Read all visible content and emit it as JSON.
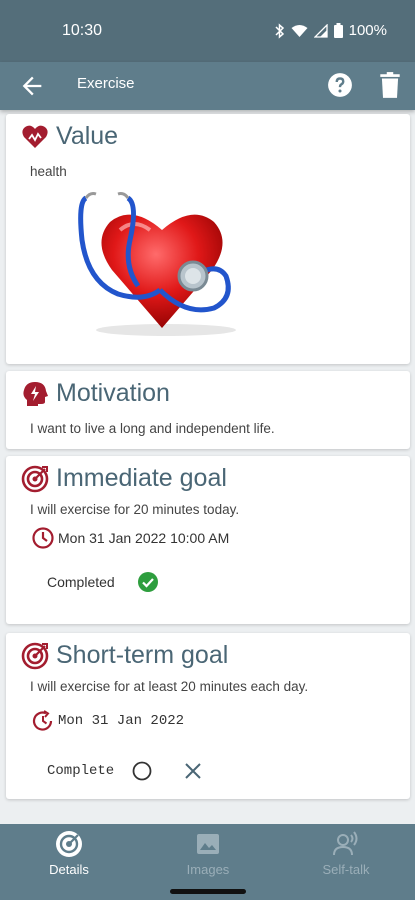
{
  "status_bar": {
    "time": "10:30",
    "battery": "100%"
  },
  "app_bar": {
    "title": "Exercise"
  },
  "value_card": {
    "title": "Value",
    "text": "health"
  },
  "motivation_card": {
    "title": "Motivation",
    "text": "I want to live a long and independent life."
  },
  "immediate_goal_card": {
    "title": "Immediate goal",
    "text": "I will exercise for 20 minutes today.",
    "date": "Mon 31 Jan 2022 10:00 AM",
    "status_label": "Completed"
  },
  "short_term_goal_card": {
    "title": "Short-term goal",
    "text": "I will exercise for at least 20 minutes each day.",
    "date": "Mon 31 Jan 2022",
    "status_label": "Complete"
  },
  "bottom_nav": {
    "items": [
      {
        "label": "Details",
        "icon": "target-icon",
        "active": true
      },
      {
        "label": "Images",
        "icon": "image-icon",
        "active": false
      },
      {
        "label": "Self-talk",
        "icon": "voice-icon",
        "active": false
      }
    ]
  },
  "colors": {
    "primary": "#5f7d8b",
    "status_bar": "#546e7a",
    "accent": "#a31d2f",
    "title": "#4a6675",
    "success": "#2e9e3e"
  }
}
